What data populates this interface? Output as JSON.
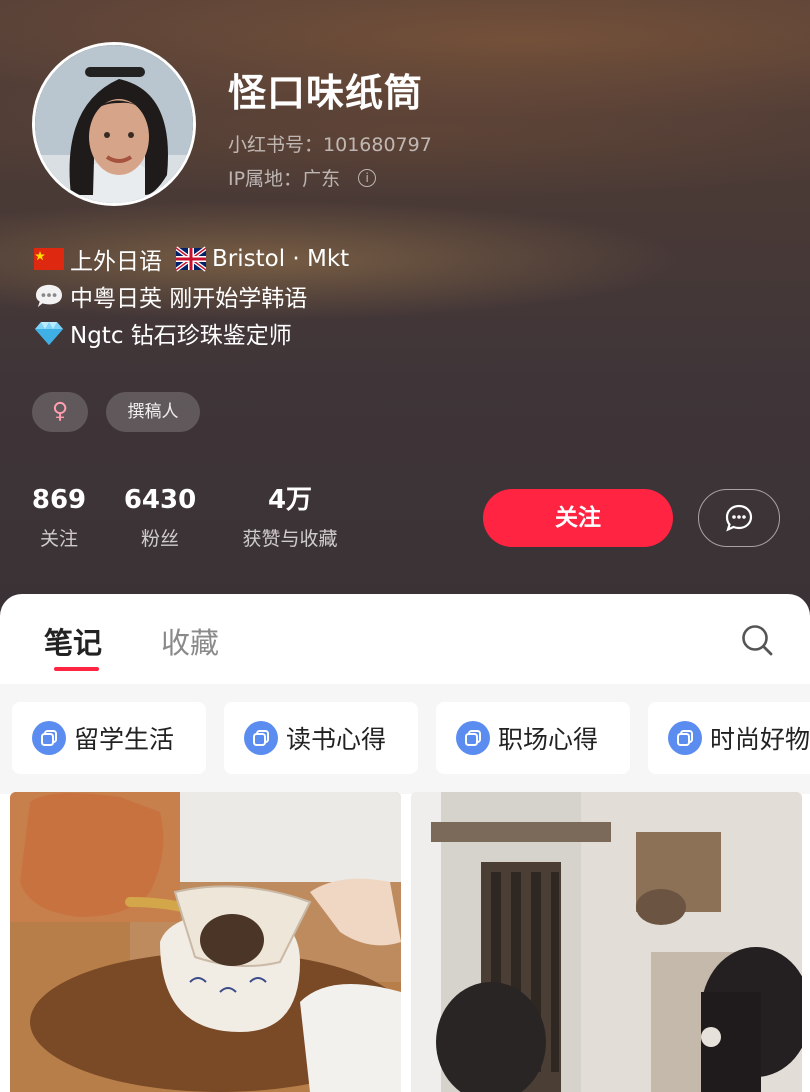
{
  "profile": {
    "username": "怪口味纸筒",
    "id_label": "小红书号：",
    "id_value": "101680797",
    "ip_label": "IP属地：",
    "ip_value": "广东",
    "bio": [
      {
        "icon": "china-flag-icon",
        "text": "上外日语"
      },
      {
        "icon": "uk-flag-icon",
        "text": "Bristol · Mkt"
      },
      {
        "icon": "speech-bubble-icon",
        "text": "中粤日英  刚开始学韩语"
      },
      {
        "icon": "diamond-icon",
        "text": "Ngtc 钻石珍珠鉴定师"
      }
    ],
    "tags": {
      "gender_icon": "female-icon",
      "gender_symbol": "♀",
      "role": "撰稿人"
    }
  },
  "stats": [
    {
      "value": "869",
      "label": "关注"
    },
    {
      "value": "6430",
      "label": "粉丝"
    },
    {
      "value": "4万",
      "label": "获赞与收藏"
    }
  ],
  "actions": {
    "follow_label": "关注",
    "message_icon": "chat-bubble-icon"
  },
  "tabs": [
    {
      "label": "笔记",
      "active": true
    },
    {
      "label": "收藏",
      "active": false
    }
  ],
  "search_icon": "search-icon",
  "collections": [
    {
      "icon": "collection-icon",
      "label": "留学生活"
    },
    {
      "icon": "collection-icon",
      "label": "读书心得"
    },
    {
      "icon": "collection-icon",
      "label": "职场心得"
    },
    {
      "icon": "collection-icon",
      "label": "时尚好物"
    }
  ],
  "colors": {
    "accent": "#ff2442",
    "chip_icon": "#5b8cf0"
  }
}
